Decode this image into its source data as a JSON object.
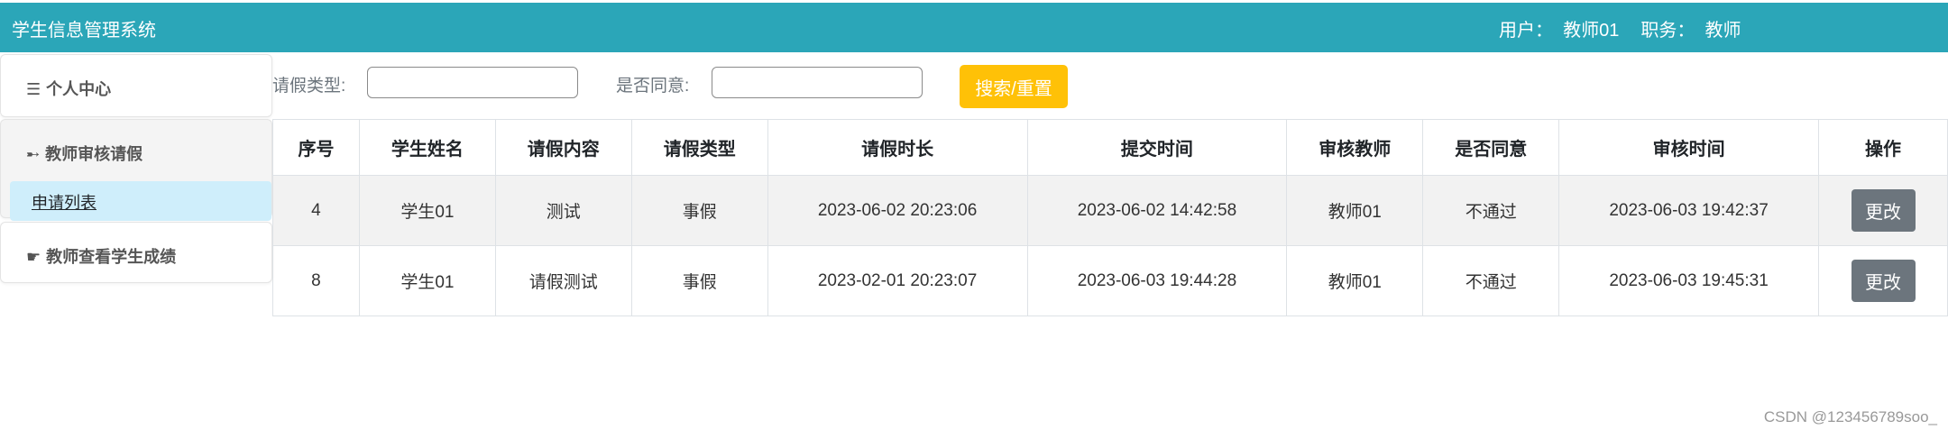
{
  "header": {
    "title": "学生信息管理系统",
    "user_text": "用户：  教师01",
    "role_text": "职务：  教师"
  },
  "sidebar": {
    "items": [
      {
        "icon": "☰",
        "label": "个人中心"
      },
      {
        "icon": "➸",
        "label": "教师审核请假",
        "sub_items": [
          {
            "label": "申请列表"
          }
        ]
      },
      {
        "icon": "☛",
        "label": "教师查看学生成绩"
      }
    ]
  },
  "filters": {
    "leave_type_label": "请假类型:",
    "leave_type_value": "",
    "approve_label": "是否同意:",
    "approve_value": "",
    "search_button": "搜索/重置"
  },
  "table": {
    "columns": [
      "序号",
      "学生姓名",
      "请假内容",
      "请假类型",
      "请假时长",
      "提交时间",
      "审核教师",
      "是否同意",
      "审核时间",
      "操作"
    ],
    "rows": [
      [
        "4",
        "学生01",
        "测试",
        "事假",
        "2023-06-02 20:23:06",
        "2023-06-02 14:42:58",
        "教师01",
        "不通过",
        "2023-06-03 19:42:37",
        "更改"
      ],
      [
        "8",
        "学生01",
        "请假测试",
        "事假",
        "2023-02-01 20:23:07",
        "2023-06-03 19:44:28",
        "教师01",
        "不通过",
        "2023-06-03 19:45:31",
        "更改"
      ]
    ]
  },
  "watermark": "CSDN @123456789soo_",
  "colors": {
    "topbar": "#2ba6b8",
    "search_button": "#ffc107",
    "edit_button": "#6c757d",
    "active_sub_item": "#cfeefb"
  }
}
